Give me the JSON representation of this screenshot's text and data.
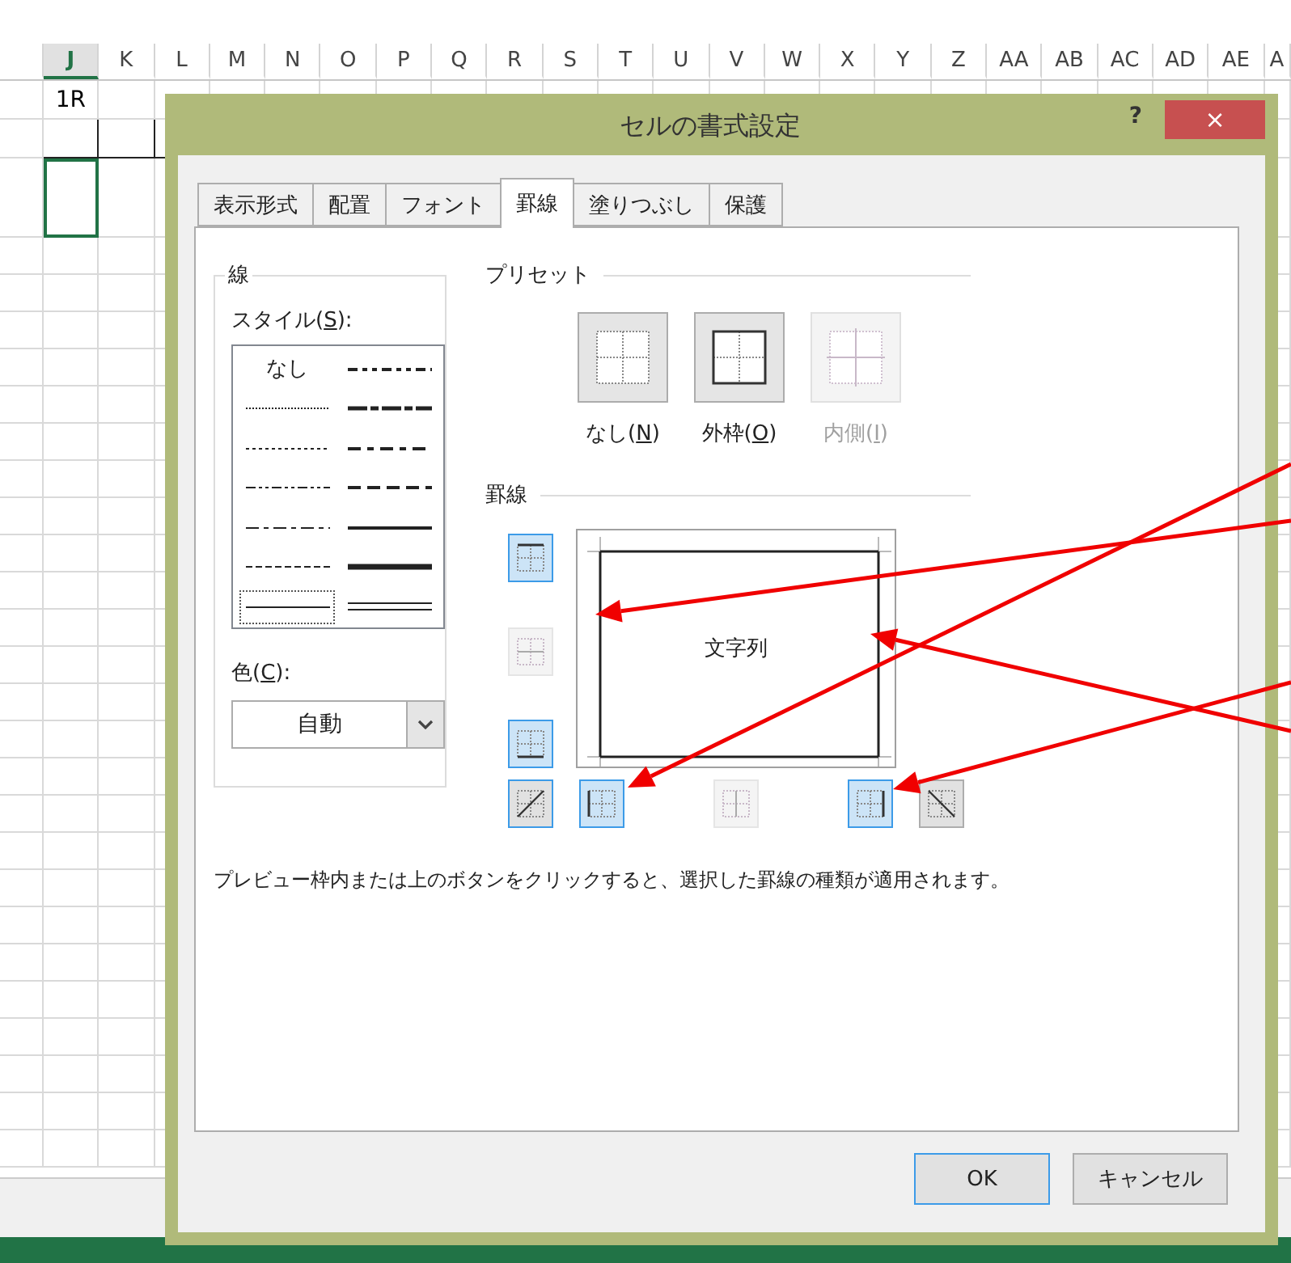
{
  "sheet": {
    "columns": [
      {
        "label": "J",
        "selected": true
      },
      {
        "label": "K",
        "selected": false
      },
      {
        "label": "L",
        "selected": false
      },
      {
        "label": "M",
        "selected": false
      },
      {
        "label": "N",
        "selected": false
      },
      {
        "label": "O",
        "selected": false
      },
      {
        "label": "P",
        "selected": false
      },
      {
        "label": "Q",
        "selected": false
      },
      {
        "label": "R",
        "selected": false
      },
      {
        "label": "S",
        "selected": false
      },
      {
        "label": "T",
        "selected": false
      },
      {
        "label": "U",
        "selected": false
      },
      {
        "label": "V",
        "selected": false
      },
      {
        "label": "W",
        "selected": false
      },
      {
        "label": "X",
        "selected": false
      },
      {
        "label": "Y",
        "selected": false
      },
      {
        "label": "Z",
        "selected": false
      },
      {
        "label": "AA",
        "selected": false
      },
      {
        "label": "AB",
        "selected": false
      },
      {
        "label": "AC",
        "selected": false
      },
      {
        "label": "AD",
        "selected": false
      },
      {
        "label": "AE",
        "selected": false
      },
      {
        "label": "A",
        "selected": false
      }
    ],
    "cell_text": "1R"
  },
  "dialog": {
    "title": "セルの書式設定",
    "help": "?",
    "close": "×",
    "tabs": [
      {
        "label": "表示形式",
        "selected": false
      },
      {
        "label": "配置",
        "selected": false
      },
      {
        "label": "フォント",
        "selected": false
      },
      {
        "label": "罫線",
        "selected": true
      },
      {
        "label": "塗りつぶし",
        "selected": false
      },
      {
        "label": "保護",
        "selected": false
      }
    ],
    "line": {
      "title": "線",
      "style_label": {
        "text": "スタイル(",
        "key": "S",
        "end": "):"
      },
      "styles": [
        {
          "kind": "none",
          "label": "なし",
          "selected": false
        },
        {
          "kind": "medium_dash_dot_dot",
          "selected": false
        },
        {
          "kind": "hair",
          "selected": false
        },
        {
          "kind": "slant_dash_dot",
          "selected": false
        },
        {
          "kind": "dotted",
          "selected": false
        },
        {
          "kind": "medium_dash_dot",
          "selected": false
        },
        {
          "kind": "dash_dot_dot",
          "selected": false
        },
        {
          "kind": "medium_dashed",
          "selected": false
        },
        {
          "kind": "dash_dot",
          "selected": false
        },
        {
          "kind": "medium",
          "selected": false
        },
        {
          "kind": "dashed",
          "selected": false
        },
        {
          "kind": "thick",
          "selected": false
        },
        {
          "kind": "thin",
          "selected": true
        },
        {
          "kind": "double",
          "selected": false
        }
      ],
      "color_label": {
        "text": "色(",
        "key": "C",
        "end": "):"
      },
      "color_value": "自動"
    },
    "preset": {
      "title": "プリセット",
      "items": [
        {
          "kind": "none",
          "text": "なし(",
          "key": "N",
          "end": ")",
          "disabled": false
        },
        {
          "kind": "outline",
          "text": "外枠(",
          "key": "O",
          "end": ")",
          "disabled": false
        },
        {
          "kind": "inside",
          "text": "内側(",
          "key": "I",
          "end": ")",
          "disabled": true
        }
      ]
    },
    "border": {
      "title": "罫線",
      "preview_text": "文字列",
      "side_buttons": [
        {
          "kind": "top",
          "on": true,
          "disabled": false
        },
        {
          "kind": "middle_horizontal",
          "on": false,
          "disabled": true
        },
        {
          "kind": "bottom",
          "on": true,
          "disabled": false
        }
      ],
      "bottom_buttons": [
        {
          "kind": "diagonal_up",
          "on": false,
          "disabled": false,
          "focused": true
        },
        {
          "kind": "left",
          "on": true,
          "disabled": false,
          "focused": false
        },
        {
          "kind": "middle_vertical",
          "on": false,
          "disabled": true,
          "focused": false
        },
        {
          "kind": "right",
          "on": true,
          "disabled": false,
          "focused": false
        },
        {
          "kind": "diagonal_down",
          "on": false,
          "disabled": false,
          "focused": false
        }
      ]
    },
    "hint": "プレビュー枠内または上のボタンをクリックすると、選択した罫線の種類が適用されます。",
    "buttons": [
      {
        "label": "OK",
        "default": true
      },
      {
        "label": "キャンセル",
        "default": false
      }
    ]
  }
}
